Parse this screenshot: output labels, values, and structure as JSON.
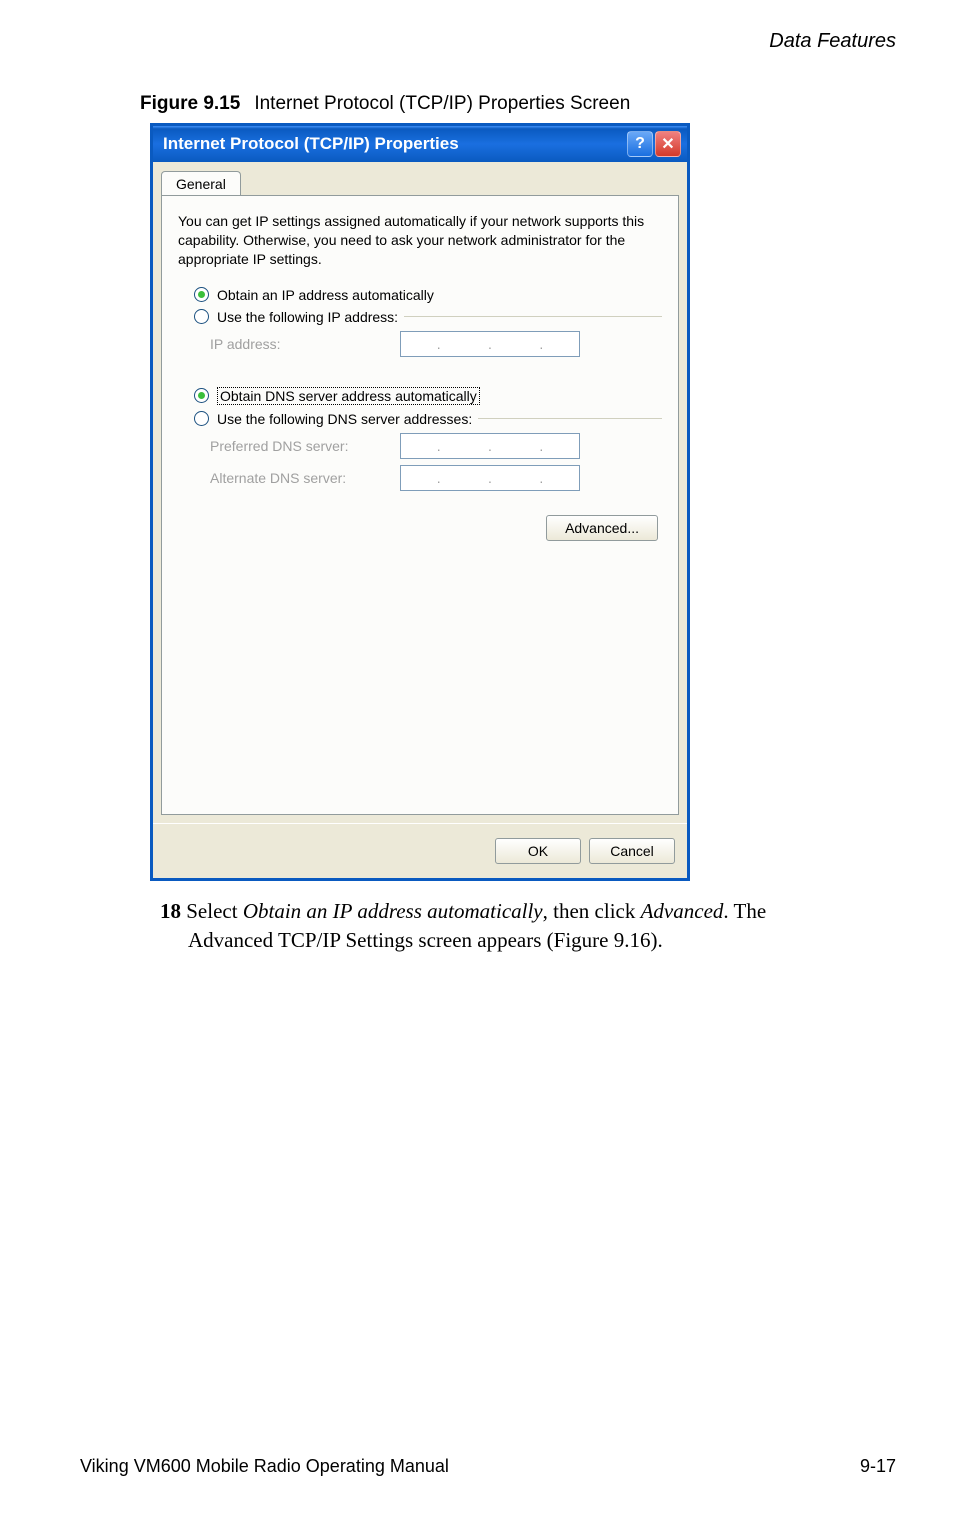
{
  "header": {
    "section": "Data Features"
  },
  "figure": {
    "label": "Figure 9.15",
    "caption": "Internet Protocol (TCP/IP) Properties Screen"
  },
  "dialog": {
    "title": "Internet Protocol (TCP/IP) Properties",
    "help_symbol": "?",
    "close_symbol": "✕",
    "tab": "General",
    "intro": "You can get IP settings assigned automatically if your network supports this capability. Otherwise, you need to ask your network administrator for the appropriate IP settings.",
    "radio_obtain_ip": "Obtain an IP address automatically",
    "radio_use_ip": "Use the following IP address:",
    "label_ip_address": "IP address:",
    "ip_dots": ". . .",
    "radio_obtain_dns": "Obtain DNS server address automatically",
    "radio_use_dns": "Use the following DNS server addresses:",
    "label_pref_dns": "Preferred DNS server:",
    "label_alt_dns": "Alternate DNS server:",
    "btn_advanced": "Advanced...",
    "btn_ok": "OK",
    "btn_cancel": "Cancel"
  },
  "step": {
    "num": "18",
    "text_before": " Select ",
    "em1": "Obtain an IP address automatically",
    "text_mid": ", then click ",
    "em2": "Advanced",
    "text_after": ". The Advanced TCP/IP Settings screen appears (Figure 9.16)."
  },
  "footer": {
    "left": "Viking VM600 Mobile Radio Operating Manual",
    "right": "9-17"
  }
}
